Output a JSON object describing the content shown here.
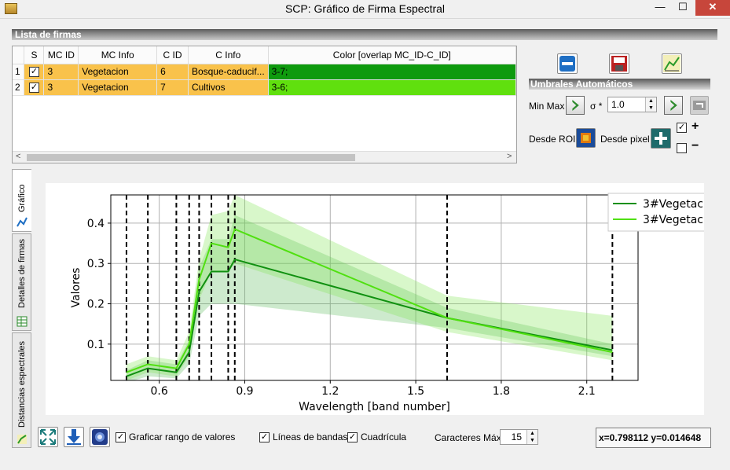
{
  "window": {
    "title": "SCP: Gráfico de Firma Espectral",
    "minimize": "—",
    "maximize": "☐",
    "close": "✕"
  },
  "signature_list": {
    "header": "Lista de firmas",
    "columns": [
      "S",
      "MC ID",
      "MC Info",
      "C ID",
      "C Info",
      "Color [overlap MC_ID-C_ID]"
    ],
    "rows": [
      {
        "num": "1",
        "checked": true,
        "mc_id": "3",
        "mc_info": "Vegetacion",
        "c_id": "6",
        "c_info": "Bosque-caducif...",
        "overlap": "3-7;",
        "color": "#0e9a0e"
      },
      {
        "num": "2",
        "checked": true,
        "mc_id": "3",
        "mc_info": "Vegetacion",
        "c_id": "7",
        "c_info": "Cultivos",
        "overlap": "3-6;",
        "color": "#60e00e"
      }
    ]
  },
  "thresholds": {
    "header": "Umbrales  Automáticos",
    "min_max_label": "Min Max",
    "sigma_label": "σ *",
    "sigma_value": "1.0",
    "from_roi_label": "Desde ROI",
    "from_pixel_label": "Desde pixel",
    "plus": "+",
    "minus": "−"
  },
  "tabs": [
    "Gráfico",
    "Detalles de firmas",
    "Distancias espectrales"
  ],
  "chart_data": {
    "type": "line",
    "xlabel": "Wavelength [band number]",
    "ylabel": "Valores",
    "xlim": [
      0.43,
      2.28
    ],
    "ylim": [
      0.01,
      0.47
    ],
    "x_ticks": [
      "0.6",
      "0.9",
      "1.2",
      "1.5",
      "1.8",
      "2.1"
    ],
    "y_ticks": [
      "0.1",
      "0.2",
      "0.3",
      "0.4"
    ],
    "grid": true,
    "legend_position": "top-right",
    "band_lines": [
      0.485,
      0.56,
      0.66,
      0.705,
      0.74,
      0.783,
      0.842,
      0.865,
      1.61,
      2.19
    ],
    "x": [
      0.485,
      0.56,
      0.66,
      0.705,
      0.74,
      0.783,
      0.842,
      0.865,
      1.61,
      2.19
    ],
    "series": [
      {
        "name": "3#Vegetac",
        "color": "#109010",
        "values": [
          0.02,
          0.04,
          0.03,
          0.08,
          0.23,
          0.28,
          0.28,
          0.31,
          0.165,
          0.085
        ],
        "band_low": [
          0.005,
          0.02,
          0.015,
          0.05,
          0.17,
          0.2,
          0.2,
          0.2,
          0.14,
          0.07
        ],
        "band_high": [
          0.035,
          0.06,
          0.05,
          0.11,
          0.29,
          0.36,
          0.36,
          0.42,
          0.19,
          0.1
        ]
      },
      {
        "name": "3#Vegetac",
        "color": "#50e010",
        "values": [
          0.03,
          0.05,
          0.04,
          0.1,
          0.26,
          0.35,
          0.34,
          0.385,
          0.165,
          0.08
        ],
        "band_low": [
          0.01,
          0.03,
          0.02,
          0.07,
          0.21,
          0.28,
          0.28,
          0.3,
          0.13,
          0.06
        ],
        "band_high": [
          0.05,
          0.07,
          0.06,
          0.13,
          0.31,
          0.42,
          0.43,
          0.47,
          0.22,
          0.17
        ]
      }
    ]
  },
  "bottom": {
    "plot_range_label": "Graficar rango de valores",
    "band_lines_label": "Líneas de bandas",
    "grid_label": "Cuadrícula",
    "max_chars_label": "Caracteres Máx",
    "max_chars_value": "15",
    "coords": "x=0.798112 y=0.014648"
  }
}
